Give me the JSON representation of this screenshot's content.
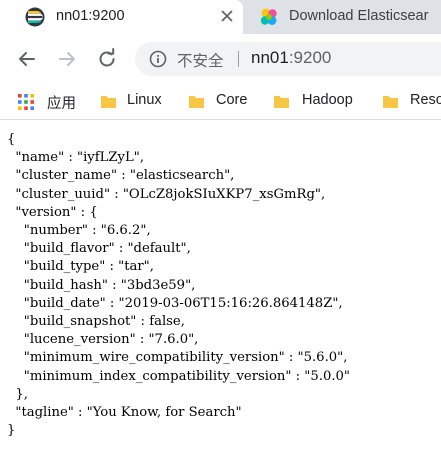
{
  "tabs": [
    {
      "title": "nn01:9200",
      "icon": "elasticsearch-favicon-icon",
      "active": true
    },
    {
      "title": "Download Elasticsear",
      "icon": "elastic-logo-icon",
      "active": false
    }
  ],
  "toolbar": {
    "security_status": "不安全",
    "url_host": "nn01",
    "url_port": ":9200"
  },
  "bookmarks": [
    {
      "label": "应用",
      "icon": "apps-grid-icon"
    },
    {
      "label": "Linux",
      "icon": "folder-icon"
    },
    {
      "label": "Core",
      "icon": "folder-icon"
    },
    {
      "label": "Hadoop",
      "icon": "folder-icon"
    },
    {
      "label": "Reso",
      "icon": "folder-icon"
    }
  ],
  "json_lines": [
    "{",
    "  \"name\" : \"iyfLZyL\",",
    "  \"cluster_name\" : \"elasticsearch\",",
    "  \"cluster_uuid\" : \"OLcZ8jokSIuXKP7_xsGmRg\",",
    "  \"version\" : {",
    "    \"number\" : \"6.6.2\",",
    "    \"build_flavor\" : \"default\",",
    "    \"build_type\" : \"tar\",",
    "    \"build_hash\" : \"3bd3e59\",",
    "    \"build_date\" : \"2019-03-06T15:16:26.864148Z\",",
    "    \"build_snapshot\" : false,",
    "    \"lucene_version\" : \"7.6.0\",",
    "    \"minimum_wire_compatibility_version\" : \"5.6.0\",",
    "    \"minimum_index_compatibility_version\" : \"5.0.0\"",
    "  },",
    "  \"tagline\" : \"You Know, for Search\"",
    "}"
  ]
}
